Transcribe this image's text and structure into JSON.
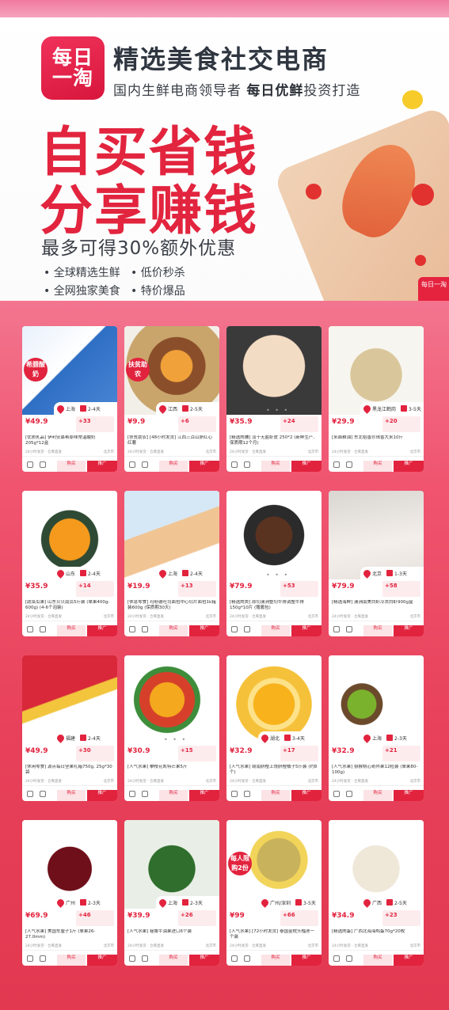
{
  "header": {
    "logo_line1": "每日",
    "logo_line2": "一淘",
    "brand_title": "精选美食社交电商",
    "brand_sub_pre": "国内生鲜电商领导者 ",
    "brand_sub_bold": "每日优鲜",
    "brand_sub_post": "投资打造",
    "slogan1": "自买省钱",
    "slogan2": "分享赚钱",
    "promo": "最多可得30%额外优惠",
    "features": [
      "全球精选生鲜",
      "低价秒杀",
      "全网独家美食",
      "特价爆品"
    ],
    "corner_badge": "每日一淘"
  },
  "common": {
    "buy_label": "购买",
    "promote_label": "推广",
    "meta_left": "24小时发货 · 仓库直发",
    "meta_right": "北京市"
  },
  "products": [
    {
      "price": "¥49.9",
      "cut": "+33",
      "name": "[优质乳品] 伊利安慕希原味常温酸奶205g*12盒",
      "loc": "上海",
      "days": "2-4天",
      "badge": "希腊酸奶",
      "img": "yogurt"
    },
    {
      "price": "¥9.9",
      "cut": "+6",
      "name": "[扶贫助农] [48小时发货] 江西三百山脐红心红薯",
      "loc": "江西",
      "days": "2-5天",
      "badge": "扶贫助农",
      "img": "sweetpotato"
    },
    {
      "price": "¥35.9",
      "cut": "+24",
      "name": "[精选肉脯] 淡干无盐虾皮 250*2 (新鲜生产, 保质期12个月)",
      "loc": "",
      "days": "",
      "badge": "",
      "img": "shrimp_dried"
    },
    {
      "price": "¥29.9",
      "cut": "+20",
      "name": "[米面粮油] 东北稻香珍珠香大米10斤",
      "loc": "黑龙江鹤岗",
      "days": "3-5天",
      "badge": "",
      "img": "rice"
    },
    {
      "price": "¥35.9",
      "cut": "+14",
      "name": "[蔬菜瓜果] 山东贝贝南瓜5斤装 (单果400g-600g) (4-6个泡装)",
      "loc": "山东",
      "days": "2-4天",
      "badge": "",
      "img": "pumpkin"
    },
    {
      "price": "¥19.9",
      "cut": "+13",
      "name": "[休息零食] 玛呖德吐司面包中心切片面包1k箱装600g (保质期30天)",
      "loc": "上海",
      "days": "2-4天",
      "badge": "",
      "img": "bread"
    },
    {
      "price": "¥79.9",
      "cut": "+53",
      "name": "[精选肉类] 原切澳洲整切牛排调整牛排150g*10片 (赠酱包)",
      "loc": "",
      "days": "",
      "badge": "",
      "img": "steak"
    },
    {
      "price": "¥79.9",
      "cut": "+58",
      "name": "[精选海鲜] 澳洲南美白虾冷冻白虾900g盒",
      "loc": "北京",
      "days": "1-3天",
      "badge": "",
      "img": "prawn"
    },
    {
      "price": "¥49.9",
      "cut": "+30",
      "name": "[休闲零食] 源点每日坚果礼箱750g, 25g*30袋",
      "loc": "福建",
      "days": "2-4天",
      "badge": "",
      "img": "nuts"
    },
    {
      "price": "¥30.9",
      "cut": "+15",
      "name": "[人气水果] 攀枝花凯特芒果5斤",
      "loc": "",
      "days": "",
      "badge": "",
      "img": "mango"
    },
    {
      "price": "¥32.9",
      "cut": "+17",
      "name": "[人气水果] 赣南脐橙上饶脐橙橘子5斤装 (约8个)",
      "loc": "湖北",
      "days": "3-4天",
      "badge": "",
      "img": "orange"
    },
    {
      "price": "¥32.9",
      "cut": "+21",
      "name": "[人气水果] 猕猴桃心奇异果12粒装 (单果80-100g)",
      "loc": "上海",
      "days": "2-3天",
      "badge": "",
      "img": "kiwi"
    },
    {
      "price": "¥69.9",
      "cut": "+46",
      "name": "[人气水果] 美国车厘子1斤 (单果26-27.0mm)",
      "loc": "广州",
      "days": "2-3天",
      "badge": "",
      "img": "cherry"
    },
    {
      "price": "¥39.9",
      "cut": "+26",
      "name": "[人气水果] 秘鲁牛油果进口6个装",
      "loc": "上海",
      "days": "2-3天",
      "badge": "",
      "img": "avocado"
    },
    {
      "price": "¥99",
      "cut": "+66",
      "name": "[人气水果] [72小时发货] 泰国金枕头榴莲一个装",
      "loc": "广州/深圳",
      "days": "3-5天",
      "badge": "每人限购2份",
      "img": "durian"
    },
    {
      "price": "¥34.9",
      "cut": "+23",
      "name": "[精选肉蛋] 广西北海海鸭蛋70g*20枚",
      "loc": "广西",
      "days": "2-5天",
      "badge": "",
      "img": "egg"
    }
  ],
  "colors": {
    "accent": "#e2233e",
    "pink_bg": "#f05570"
  }
}
